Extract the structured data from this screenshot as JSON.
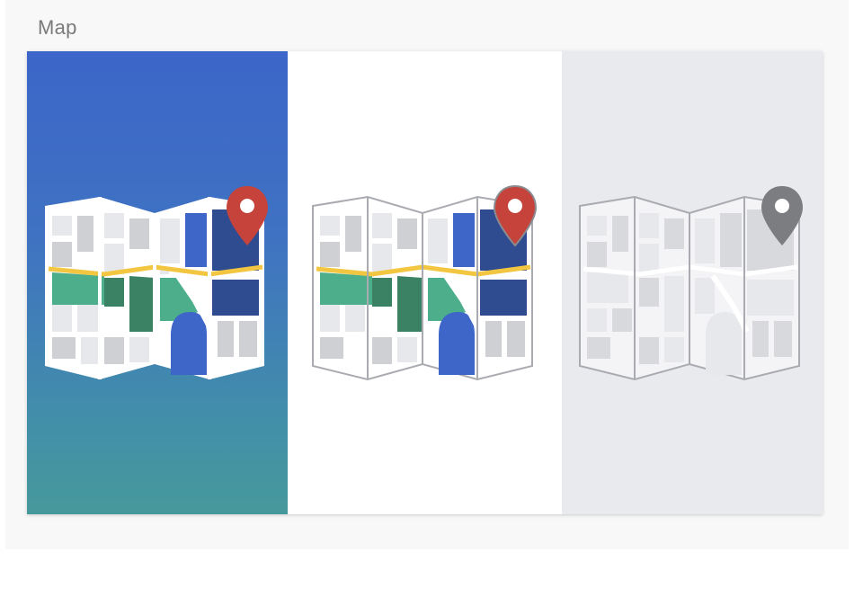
{
  "header": {
    "title": "Map"
  },
  "variants": [
    {
      "id": "color-on-gradient",
      "style": "full-color",
      "background": "gradient"
    },
    {
      "id": "color-on-white",
      "style": "full-color",
      "background": "#ffffff"
    },
    {
      "id": "monochrome-on-gray",
      "style": "grayscale",
      "background": "#e9eaee"
    }
  ],
  "colors": {
    "gradient_top": "#3c66c9",
    "gradient_bottom": "#46999b",
    "map_blue": "#3d66c8",
    "map_dark_blue": "#2f4c91",
    "map_green": "#4cae8a",
    "map_dark_green": "#3b8164",
    "road_yellow": "#f2c640",
    "pin_red": "#c5433b",
    "pin_gray": "#7c7d81",
    "block_light": "#e7e8ec",
    "block_mid": "#cfd0d4",
    "outline_gray": "#a9abb0"
  },
  "icons": [
    "folded-map-icon",
    "location-pin-icon"
  ]
}
